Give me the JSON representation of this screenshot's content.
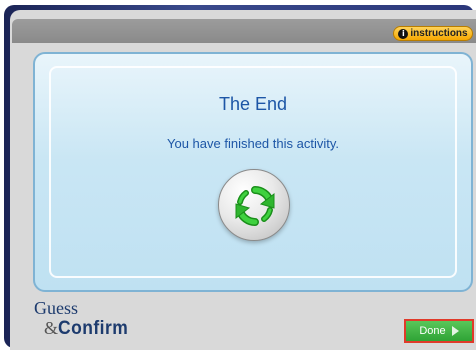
{
  "header": {
    "instructions_label": "instructions",
    "info_icon_glyph": "i"
  },
  "content": {
    "title": "The End",
    "message": "You have finished this activity.",
    "restart_icon": "refresh-arrows-icon"
  },
  "brand": {
    "line1": "Guess",
    "ampersand": "&",
    "line2": "Confirm"
  },
  "footer": {
    "done_label": "Done",
    "done_icon": "play-arrow-icon"
  },
  "colors": {
    "frame": "#2b377a",
    "panel": "#c9e6f4",
    "title_text": "#1d56a6",
    "instructions": "#f6a800",
    "done_button": "#2fa335",
    "done_border": "#e03a2a",
    "restart_arrows": "#2fb52f"
  }
}
